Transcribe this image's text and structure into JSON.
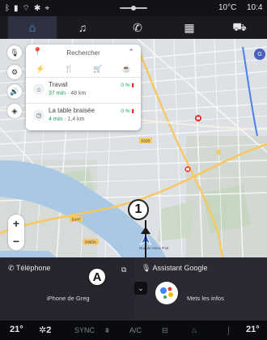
{
  "status": {
    "temperature": "10°C",
    "time": "10:4"
  },
  "nav_tabs": [
    {
      "name": "home",
      "icon": "home-icon",
      "glyph": "⌂",
      "active": true
    },
    {
      "name": "music",
      "icon": "music-icon",
      "glyph": "♫",
      "active": false
    },
    {
      "name": "phone",
      "icon": "phone-icon",
      "glyph": "✆",
      "active": false
    },
    {
      "name": "apps",
      "icon": "apps-grid-icon",
      "glyph": "▦",
      "active": false
    },
    {
      "name": "vehicle",
      "icon": "car-icon",
      "glyph": "⛟",
      "active": false
    }
  ],
  "search": {
    "label": "Rechercher"
  },
  "categories": [
    {
      "icon": "charging-icon",
      "glyph": "⚡"
    },
    {
      "icon": "restaurant-icon",
      "glyph": "🍴"
    },
    {
      "icon": "shopping-cart-icon",
      "glyph": "🛒"
    },
    {
      "icon": "coffee-icon",
      "glyph": "☕"
    }
  ],
  "destinations": [
    {
      "name": "Travail",
      "minutes": "37 min",
      "distance": "48 km",
      "battery": "0 %",
      "icon": "work-briefcase-icon"
    },
    {
      "name": "La table braisée",
      "minutes": "4 min",
      "distance": "1,4 km",
      "battery": "0 %",
      "icon": "history-icon"
    }
  ],
  "map": {
    "road_labels": [
      "D147",
      "D903A",
      "D183"
    ],
    "place_label": "Rue du Vieux Port",
    "profile_letter": "G"
  },
  "callouts": {
    "one": "1",
    "a": "A"
  },
  "widgets": {
    "phone": {
      "title": "Téléphone",
      "device": "iPhone de Greg"
    },
    "assistant": {
      "title": "Assistant Google",
      "subtitle": "Mets les infos"
    }
  },
  "bottom": {
    "temp_left": "21°",
    "fan_level": "2",
    "sync": "SYNC",
    "ac": "A/C",
    "temp_right": "21°"
  },
  "colors": {
    "accent": "#56a6f2",
    "map_bg": "#dfe3e8",
    "route_green": "#19a15f",
    "battery_red": "#e0312f"
  }
}
